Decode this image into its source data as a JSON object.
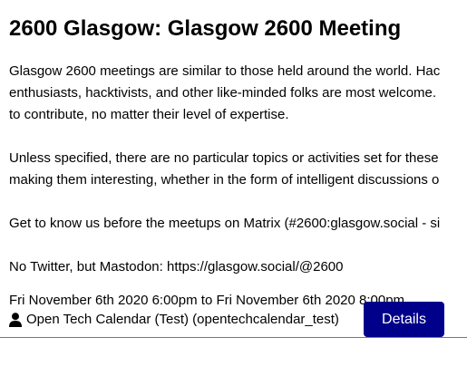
{
  "event": {
    "title": "2600 Glasgow: Glasgow 2600 Meeting",
    "description_lines": [
      "Glasgow 2600 meetings are similar to those held around the world. Hac",
      "enthusiasts, hacktivists, and other like-minded folks are most welcome.",
      "to contribute, no matter their level of expertise.",
      "Unless specified, there are no particular topics or activities set for these",
      "making them interesting, whether in the form of intelligent discussions o",
      "Get to know us before the meetups on Matrix (#2600:glasgow.social - si",
      "No Twitter, but Mastodon: https://glasgow.social/@2600"
    ],
    "time_text": "Fri November 6th 2020 6:00pm to Fri November 6th 2020 8:00pm",
    "organiser_text": "Open Tech Calendar (Test) (opentechcalendar_test)",
    "details_label": "Details",
    "user_icon": "user-icon",
    "button_color": "#00008b"
  }
}
